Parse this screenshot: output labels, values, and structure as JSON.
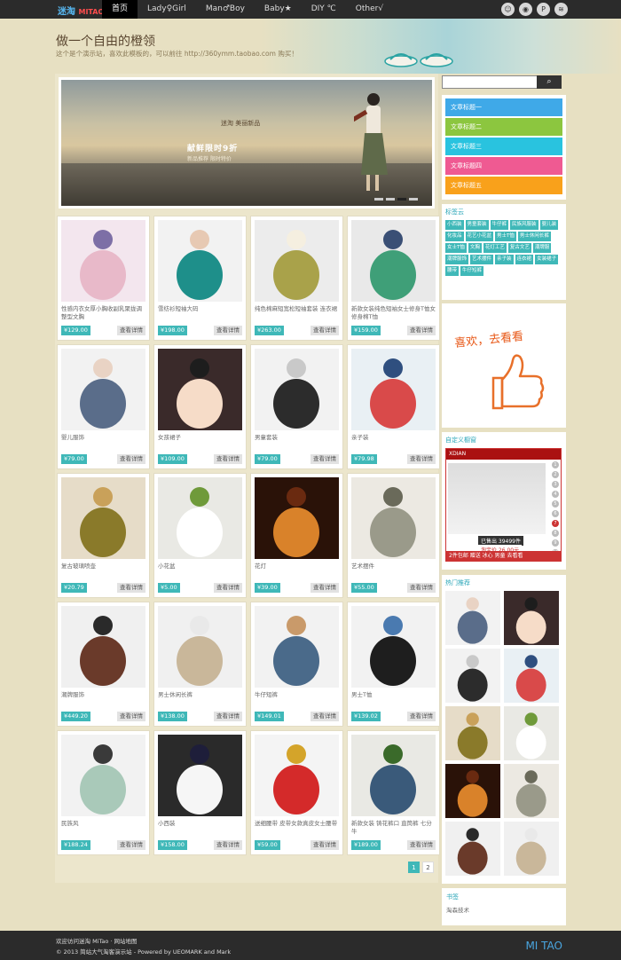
{
  "topbar": {
    "logo_cn": "迷淘",
    "logo_en": "MITAO",
    "nav": [
      "首页",
      "Lady♀Girl",
      "Man♂Boy",
      "Baby★",
      "DIY ℃",
      "Other√"
    ],
    "icons": [
      "qq-icon",
      "eye-icon",
      "pinterest-icon",
      "rss-icon"
    ]
  },
  "header": {
    "title": "做一个自由的橙领",
    "desc": "这个是个演示站，喜欢此模板的，可以前往 http://360ymm.taobao.com 购买！"
  },
  "slider": {
    "brand": "迷淘 美丽新品",
    "tag1": "献鲜限时9折",
    "tag2": "新品推荐 限时特价"
  },
  "products": [
    {
      "name": "性感内衣女厚小胸收副乳聚拢调整型文胸",
      "price": "¥129.00",
      "img": "lingerie"
    },
    {
      "name": "雪纺衫短袖大码",
      "price": "¥198.00",
      "img": "teal-top"
    },
    {
      "name": "纯色棉麻短宽松短袖套装 连衣裙",
      "price": "¥263.00",
      "img": "olive-dress"
    },
    {
      "name": "新款女装纯色短袖女士修身T恤女修身棉T恤",
      "price": "¥159.00",
      "img": "green-tee"
    },
    {
      "name": "婴儿服饰",
      "price": "¥79.00",
      "img": "baby"
    },
    {
      "name": "女孩裙子",
      "price": "¥109.00",
      "img": "girl-dress"
    },
    {
      "name": "男童套装",
      "price": "¥79.00",
      "img": "boy-suit"
    },
    {
      "name": "亲子装",
      "price": "¥79.98",
      "img": "family"
    },
    {
      "name": "复古玻璃喷壶",
      "price": "¥20.79",
      "img": "sprayer"
    },
    {
      "name": "小花盆",
      "price": "¥5.00",
      "img": "pots"
    },
    {
      "name": "花灯",
      "price": "¥39.00",
      "img": "lights"
    },
    {
      "name": "艺术摆件",
      "price": "¥55.00",
      "img": "owls"
    },
    {
      "name": "潮牌服饰",
      "price": "¥449.20",
      "img": "man-brown"
    },
    {
      "name": "男士休闲长裤",
      "price": "¥138.00",
      "img": "pants"
    },
    {
      "name": "牛仔短裤",
      "price": "¥149.01",
      "img": "shorts"
    },
    {
      "name": "男士T恤",
      "price": "¥139.02",
      "img": "polo"
    },
    {
      "name": "民族风",
      "price": "¥188.24",
      "img": "ethnic"
    },
    {
      "name": "小西装",
      "price": "¥158.00",
      "img": "blazer"
    },
    {
      "name": "送细腰带 皮带女款真皮女士腰带",
      "price": "¥59.00",
      "img": "belt"
    },
    {
      "name": "新款女装 铸花裤口 直筒裤 七分牛",
      "price": "¥189.00",
      "img": "jeans"
    }
  ],
  "detail_label": "查看详情",
  "pager": [
    "1",
    "2"
  ],
  "search": {
    "placeholder": "",
    "button": "⌕"
  },
  "categories": [
    {
      "label": "文章标题一",
      "color": "#3fa9e8"
    },
    {
      "label": "文章标题二",
      "color": "#8cc63f"
    },
    {
      "label": "文章标题三",
      "color": "#29c3df"
    },
    {
      "label": "文章标题四",
      "color": "#ef5a92"
    },
    {
      "label": "文章标题五",
      "color": "#f9a11b"
    }
  ],
  "tagcloud": {
    "title": "标签云",
    "tags": [
      "小西装",
      "男童套装",
      "牛仔裤",
      "民族风服装",
      "婴儿装",
      "化妆品",
      "花艺小花盆",
      "男士T恤",
      "男士休闲长裤",
      "女士T恤",
      "文胸",
      "花灯工艺",
      "复古文艺",
      "潮牌服",
      "潮牌服饰",
      "艺术摆件",
      "亲子装",
      "连衣裙",
      "女装裙子",
      "腰带",
      "牛仔短裤"
    ]
  },
  "like": {
    "text": "喜欢，去看看"
  },
  "ad": {
    "title": "自定义橱窗",
    "head": "XDIAN",
    "nums": [
      "1",
      "2",
      "3",
      "4",
      "5",
      "6",
      "7",
      "8",
      "9",
      "10"
    ],
    "sold": "已售出 39499件",
    "price": "淘宝价 26.00元",
    "bar": "2件包邮 赠送 冰心 男童 去看看"
  },
  "hot": {
    "title": "热门推荐",
    "imgs": [
      "baby",
      "girl-dress",
      "boy-suit",
      "family",
      "sprayer",
      "pots",
      "lights",
      "owls",
      "man-brown",
      "pants"
    ]
  },
  "books": {
    "title": "书签",
    "sub": "淘森技术"
  },
  "footer": {
    "l1": "欢迎访问迷淘 MiTao · 网站地图",
    "l2": "© 2013 简站大气淘客演示站 - Powered by UEOMARK and Mark",
    "brand": "MI TAO"
  }
}
